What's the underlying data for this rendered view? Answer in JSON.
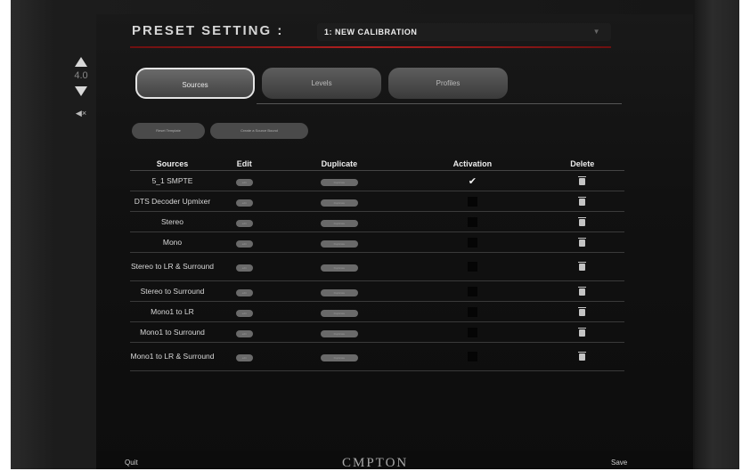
{
  "side": {
    "volume": "4.0"
  },
  "header": {
    "title": "PRESET SETTING :",
    "preset_value": "1: NEW CALIBRATION"
  },
  "tabs": [
    {
      "label": "Sources"
    },
    {
      "label": "Levels"
    },
    {
      "label": "Profiles"
    }
  ],
  "actions": {
    "reset": "Reset Template",
    "create": "Create a Source Bound"
  },
  "table": {
    "headers": [
      "Sources",
      "Edit",
      "Duplicate",
      "Activation",
      "Delete"
    ],
    "edit_label": "edit",
    "duplicate_label": "Duplicate",
    "rows": [
      {
        "name": "5_1 SMPTE",
        "active": true
      },
      {
        "name": "DTS Decoder Upmixer",
        "active": false
      },
      {
        "name": "Stereo",
        "active": false
      },
      {
        "name": "Mono",
        "active": false
      },
      {
        "name": "Stereo to LR & Surround",
        "active": false
      },
      {
        "name": "Stereo to Surround",
        "active": false
      },
      {
        "name": "Mono1 to LR",
        "active": false
      },
      {
        "name": "Mono1 to Surround",
        "active": false
      },
      {
        "name": "Mono1 to LR & Surround",
        "active": false
      }
    ]
  },
  "footer": {
    "quit": "Quit",
    "save": "Save",
    "logo": "CMPTON"
  },
  "colors": {
    "accent_red": "#b02020",
    "background": "#111111"
  }
}
